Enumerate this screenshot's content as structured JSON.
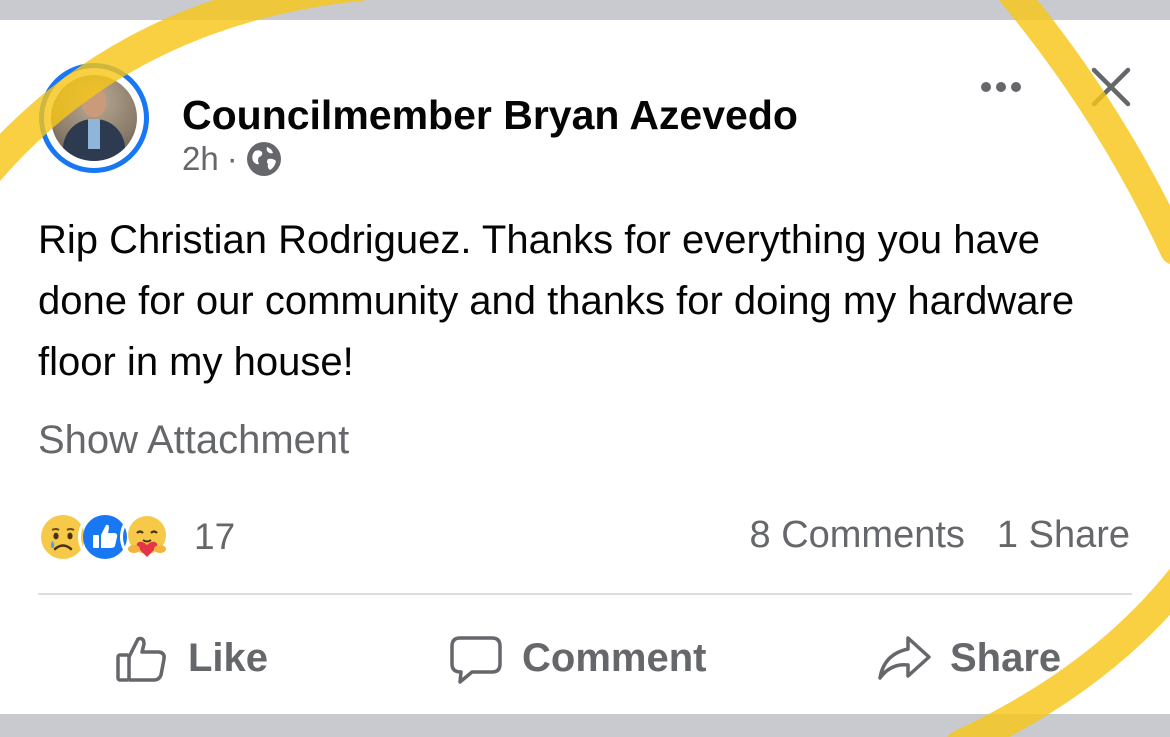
{
  "post": {
    "author": "Councilmember Bryan Azevedo",
    "time": "2h",
    "separator": "·",
    "privacy_icon": "globe-icon",
    "text": "Rip Christian Rodriguez. Thanks for everything you have done for our community and thanks for doing my hardware floor in my house!",
    "attachment_link": "Show Attachment"
  },
  "engagement": {
    "reaction_icons": [
      "sad-emoji-icon",
      "like-emoji-icon",
      "care-emoji-icon"
    ],
    "reaction_count": "17",
    "comments": "8 Comments",
    "shares": "1 Share"
  },
  "actions": {
    "like": "Like",
    "comment": "Comment",
    "share": "Share"
  },
  "colors": {
    "accent": "#1877f2",
    "text_primary": "#050505",
    "text_secondary": "#65676b",
    "highlight_overlay": "#f7c619"
  }
}
